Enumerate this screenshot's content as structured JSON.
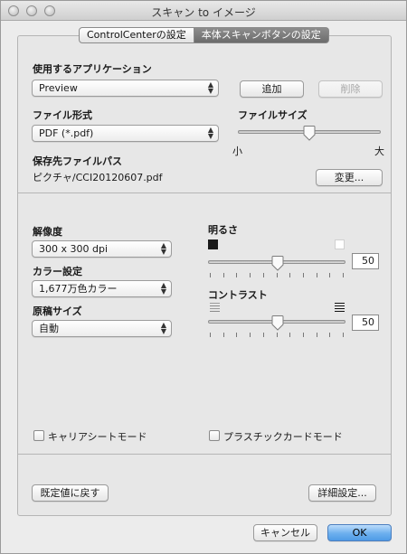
{
  "window": {
    "title": "スキャン to イメージ"
  },
  "tabs": [
    {
      "label": "ControlCenterの設定",
      "active": false
    },
    {
      "label": "本体スキャンボタンの設定",
      "active": true
    }
  ],
  "application": {
    "label": "使用するアプリケーション",
    "value": "Preview",
    "add_label": "追加",
    "delete_label": "削除"
  },
  "file_type": {
    "label": "ファイル形式",
    "value": "PDF (*.pdf)"
  },
  "file_size": {
    "label": "ファイルサイズ",
    "min_label": "小",
    "max_label": "大",
    "level": 0.5
  },
  "save_path": {
    "label": "保存先ファイルパス",
    "value": "ピクチャ/CCI20120607.pdf",
    "change_label": "変更..."
  },
  "resolution": {
    "label": "解像度",
    "value": "300 x 300 dpi"
  },
  "color": {
    "label": "カラー設定",
    "value": "1,677万色カラー"
  },
  "doc_size": {
    "label": "原稿サイズ",
    "value": "自動"
  },
  "brightness": {
    "label": "明るさ",
    "value": "50",
    "level": 0.5
  },
  "contrast": {
    "label": "コントラスト",
    "value": "50",
    "level": 0.5
  },
  "carrier_sheet": {
    "label": "キャリアシートモード",
    "checked": false
  },
  "plastic_card": {
    "label": "プラスチックカードモード",
    "checked": false
  },
  "footer": {
    "restore_label": "既定値に戻す",
    "advanced_label": "詳細設定...",
    "cancel_label": "キャンセル",
    "ok_label": "OK"
  },
  "colors": {
    "ok_button": "#5aa2e9",
    "tab_active": "#7a7a7a"
  }
}
